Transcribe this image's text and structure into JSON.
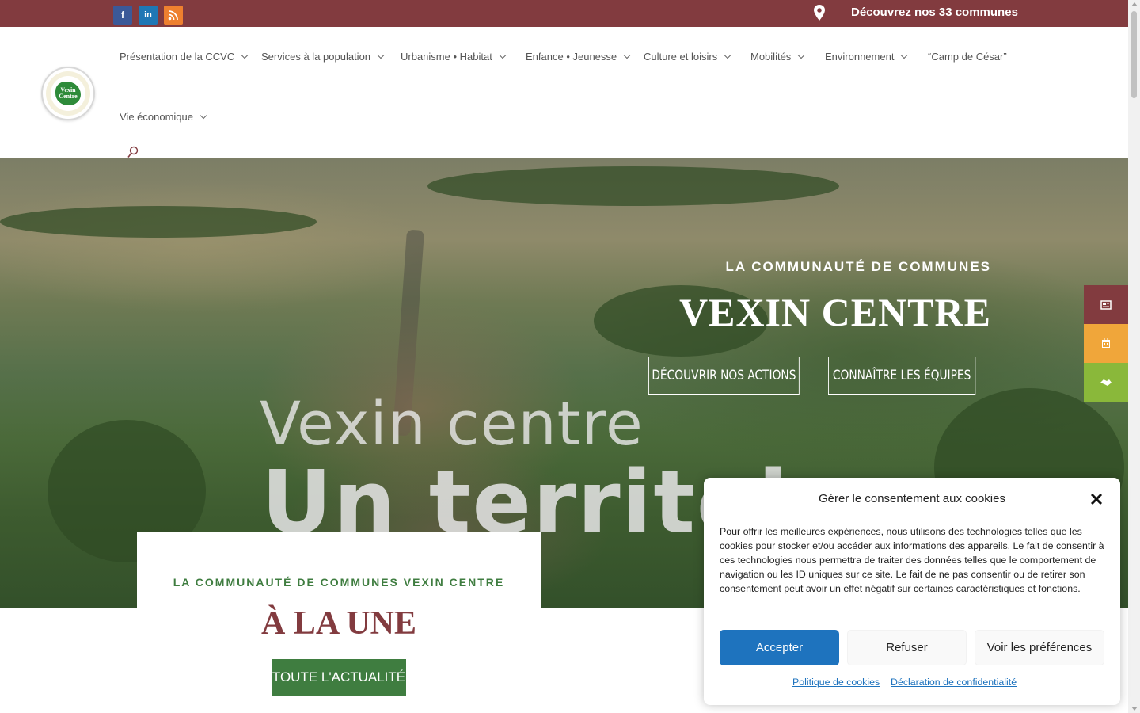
{
  "topbar": {
    "social": [
      {
        "icon": "facebook-icon",
        "glyph": "f"
      },
      {
        "icon": "linkedin-icon",
        "glyph": "in"
      },
      {
        "icon": "rss-icon",
        "glyph": "rss"
      }
    ],
    "communes_link": "Découvrez nos 33 communes"
  },
  "nav": {
    "items": [
      {
        "label": "Présentation de la CCVC",
        "has_submenu": true
      },
      {
        "label": "Services à la population",
        "has_submenu": true
      },
      {
        "label": "Urbanisme • Habitat",
        "has_submenu": true
      },
      {
        "label": "Enfance • Jeunesse",
        "has_submenu": true
      },
      {
        "label": "Culture et loisirs",
        "has_submenu": true
      },
      {
        "label": "Mobilités",
        "has_submenu": true
      },
      {
        "label": "Environnement",
        "has_submenu": true
      },
      {
        "label": "“Camp de César”",
        "has_submenu": false
      },
      {
        "label": "Vie économique",
        "has_submenu": true
      }
    ]
  },
  "logo": {
    "line1": "Vexin",
    "line2": "Centre"
  },
  "hero": {
    "kicker": "LA COMMUNAUTÉ DE COMMUNES",
    "title": "VEXIN CENTRE",
    "button_actions": "DÉCOUVRIR NOS ACTIONS",
    "button_teams": "CONNAÎTRE LES ÉQUIPES",
    "video_text_1": "Vexin centre",
    "video_text_2": "Un territoi"
  },
  "side_buttons": [
    {
      "icon": "newspaper-icon",
      "color": "#823b3f"
    },
    {
      "icon": "calendar-icon",
      "color": "#f0a63a"
    },
    {
      "icon": "handshake-icon",
      "color": "#8ab83a"
    }
  ],
  "news": {
    "kicker": "LA COMMUNAUTÉ DE COMMUNES VEXIN CENTRE",
    "title": "À LA UNE",
    "button": "TOUTE L'ACTUALITÉ"
  },
  "cookie": {
    "title": "Gérer le consentement aux cookies",
    "text": "Pour offrir les meilleures expériences, nous utilisons des technologies telles que les cookies pour stocker et/ou accéder aux informations des appareils. Le fait de consentir à ces technologies nous permettra de traiter des données telles que le comportement de navigation ou les ID uniques sur ce site. Le fait de ne pas consentir ou de retirer son consentement peut avoir un effet négatif sur certaines caractéristiques et fonctions.",
    "accept": "Accepter",
    "refuse": "Refuser",
    "preferences": "Voir les préférences",
    "link_cookies": "Politique de cookies",
    "link_privacy": "Déclaration de confidentialité"
  },
  "colors": {
    "brand_red": "#823b3f",
    "brand_green": "#3f7d40",
    "accent_blue": "#1e73be",
    "orange": "#f0a63a",
    "lime": "#8ab83a"
  }
}
